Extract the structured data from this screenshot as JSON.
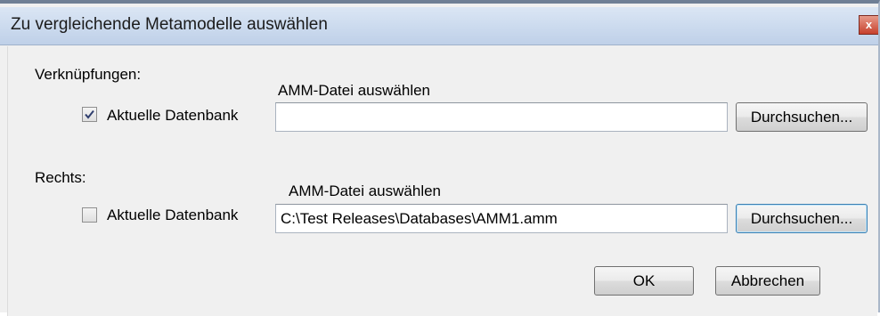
{
  "window": {
    "title": "Zu vergleichende Metamodelle auswählen",
    "close_glyph": "x"
  },
  "left_group": {
    "heading": "Verknüpfungen:",
    "checkbox_label": "Aktuelle Datenbank",
    "checkbox_checked": true,
    "file_label": "AMM-Datei auswählen",
    "file_value": "",
    "browse_label": "Durchsuchen..."
  },
  "right_group": {
    "heading": "Rechts:",
    "checkbox_label": "Aktuelle Datenbank",
    "checkbox_checked": false,
    "file_label": "AMM-Datei auswählen",
    "file_value": "C:\\Test Releases\\Databases\\AMM1.amm",
    "browse_label": "Durchsuchen..."
  },
  "buttons": {
    "ok_label": "OK",
    "cancel_label": "Abbrechen"
  }
}
